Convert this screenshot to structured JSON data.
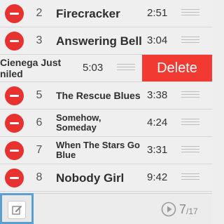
{
  "tracks": [
    {
      "num": "2",
      "title": "Firecracker",
      "time": "2:51"
    },
    {
      "num": "3",
      "title": "Answering Bell",
      "time": "3:04"
    },
    {
      "title_line1": "Cienega Just",
      "title_line2": "niled",
      "time": "5:03",
      "action": "Delete"
    },
    {
      "num": "5",
      "title": "The Rescue Blues",
      "time": "3:38"
    },
    {
      "num": "6",
      "title": "Somehow, Someday",
      "time": "4:24"
    },
    {
      "num": "7",
      "title": "When The Stars Go Blue",
      "time": "3:31"
    },
    {
      "num": "8",
      "title": "Nobody Girl",
      "time": "9:42"
    }
  ],
  "toolbar": {
    "edit_icon": "edit-icon",
    "play_icon": "play-circle-icon",
    "page_current": "7",
    "page_total": "/17"
  },
  "colors": {
    "delete_red": "#f03a32",
    "remove_circle": "#e8322f",
    "focus_blue": "#5a9fd0"
  }
}
